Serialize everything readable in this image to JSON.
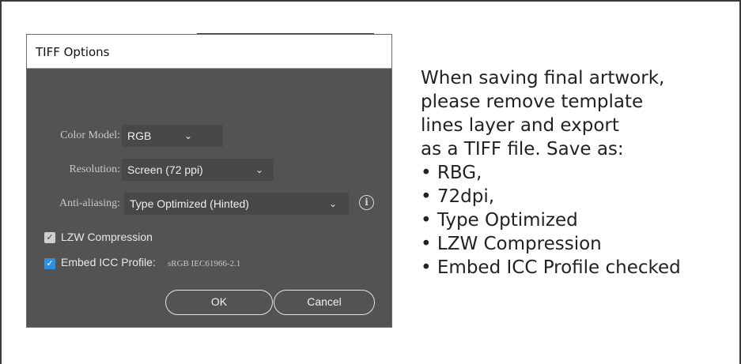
{
  "dialog": {
    "title": "TIFF Options",
    "color_model": {
      "label": "Color Model:",
      "value": "RGB"
    },
    "resolution": {
      "label": "Resolution:",
      "value": "Screen (72 ppi)"
    },
    "anti_aliasing": {
      "label": "Anti-aliasing:",
      "value": "Type Optimized (Hinted)"
    },
    "lzw": {
      "label": "LZW Compression",
      "checked": true
    },
    "embed_icc": {
      "label": "Embed ICC Profile:",
      "checked": true,
      "value": "sRGB IEC61966-2.1"
    },
    "ok_label": "OK",
    "cancel_label": "Cancel",
    "info_icon": "i"
  },
  "instructions": {
    "lines": [
      "When saving final artwork,",
      "please remove template",
      "lines layer and export",
      "as a TIFF file. Save as:"
    ],
    "bullets": [
      "• RBG,",
      "• 72dpi,",
      "• Type Optimized",
      "• LZW Compression",
      "• Embed ICC Profile checked"
    ]
  },
  "icons": {
    "chevron": "chevron-down-icon",
    "info": "info-icon",
    "check": "checkmark-icon"
  },
  "colors": {
    "dialog_bg": "#535353",
    "select_bg": "#484848",
    "checkbox_blue": "#2f8fe0"
  }
}
